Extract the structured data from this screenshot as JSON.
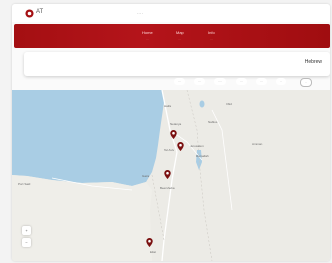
{
  "app": {
    "logo_text": "AT",
    "center_text": "··· ·",
    "logo_color": "#a40f12"
  },
  "banner": {
    "color": "#a40f12",
    "tabs": [
      {
        "label": "Home",
        "sub": "···"
      },
      {
        "label": "Map",
        "sub": "···"
      },
      {
        "label": "Info",
        "sub": "···"
      }
    ]
  },
  "search": {
    "title": "Hebrew"
  },
  "filters": {
    "chips": [
      "···",
      "···",
      "····",
      "···",
      "···",
      "··",
      "··"
    ]
  },
  "map": {
    "sea_color": "#a9cde4",
    "land_color": "#ecebe6",
    "places": [
      "Haifa",
      "Netanya",
      "Tel Aviv",
      "Jerusalem",
      "Gaza",
      "Amman",
      "Port Said",
      "Beersheba",
      "Nablus",
      "Ramallah",
      "Irbid",
      "Eilat"
    ],
    "pins": [
      {
        "name": "Tel Aviv"
      },
      {
        "name": "Jerusalem"
      },
      {
        "name": "Hebron"
      },
      {
        "name": "Eilat"
      }
    ],
    "controls": [
      "+",
      "−"
    ]
  }
}
